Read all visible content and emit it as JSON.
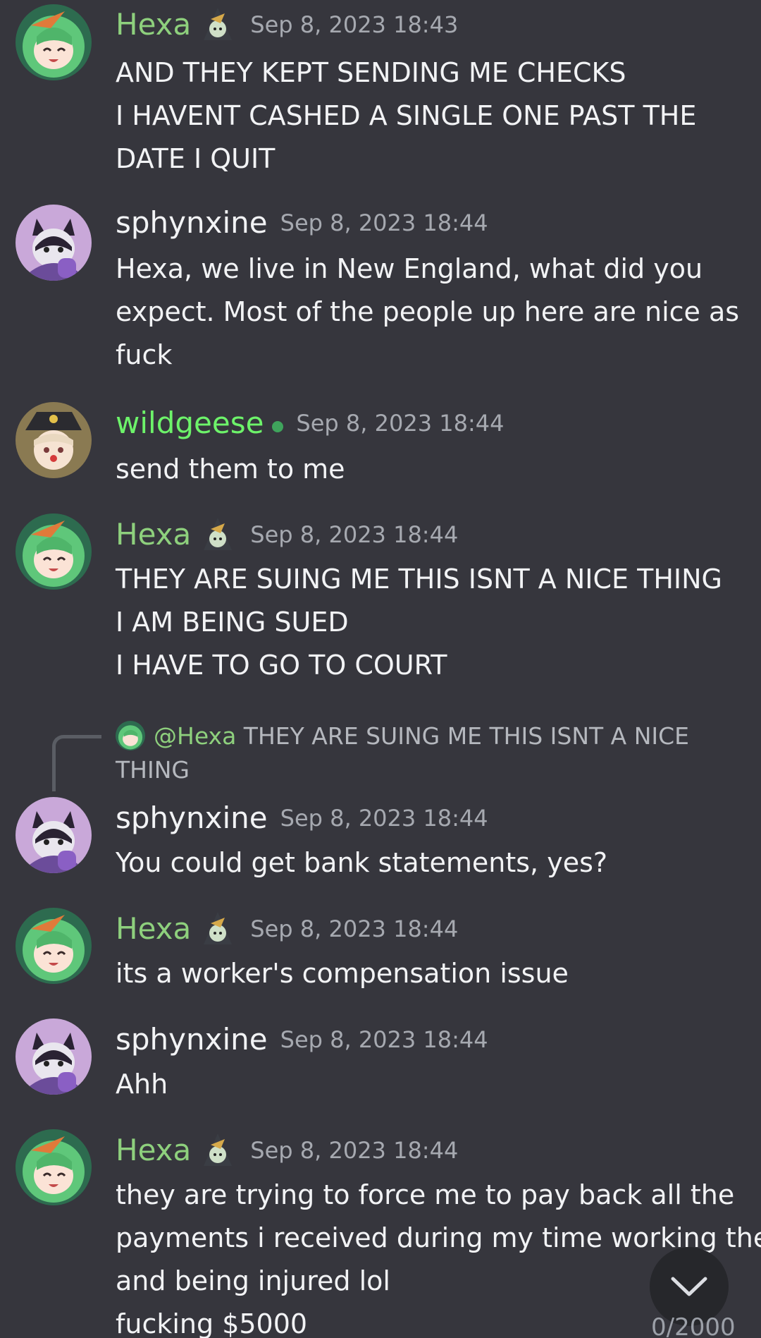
{
  "colors": {
    "background": "#36363d",
    "hexa_name": "#8ed07d",
    "sphynxine_name": "#f2f3f5",
    "wildgeese_name": "#6df36a",
    "online_dot": "#3fa45c",
    "timestamp": "#a6a9b0"
  },
  "messages": [
    {
      "author": "Hexa",
      "timestamp": "Sep 8, 2023 18:43",
      "lines": [
        "AND THEY KEPT SENDING ME CHECKS",
        "I HAVENT CASHED A SINGLE ONE PAST THE",
        "DATE I QUIT"
      ]
    },
    {
      "author": "sphynxine",
      "timestamp": "Sep 8, 2023 18:44",
      "lines": [
        "Hexa, we live in New England, what did you",
        "expect. Most of the people up here are nice as",
        "fuck"
      ]
    },
    {
      "author": "wildgeese",
      "timestamp": "Sep 8, 2023 18:44",
      "lines": [
        "send them to me"
      ]
    },
    {
      "author": "Hexa",
      "timestamp": "Sep 8, 2023 18:44",
      "lines": [
        "THEY ARE SUING ME THIS ISNT A NICE THING",
        "I AM BEING SUED",
        "I HAVE TO GO TO COURT"
      ]
    },
    {
      "author": "sphynxine",
      "timestamp": "Sep 8, 2023 18:44",
      "lines": [
        "You could get bank statements, yes?"
      ]
    },
    {
      "author": "Hexa",
      "timestamp": "Sep 8, 2023 18:44",
      "lines": [
        "its a worker's compensation issue"
      ]
    },
    {
      "author": "sphynxine",
      "timestamp": "Sep 8, 2023 18:44",
      "lines": [
        "Ahh"
      ]
    },
    {
      "author": "Hexa",
      "timestamp": "Sep 8, 2023 18:44",
      "lines": [
        "they are trying to force me to pay back all the",
        "payments i received during my time working there",
        "and being injured lol",
        "fucking $5000"
      ]
    }
  ],
  "reply": {
    "mention": "@Hexa",
    "text": "THEY ARE SUING ME THIS ISNT A NICE THING"
  },
  "composer": {
    "char_counter": "0/2000"
  },
  "icons": {
    "scroll_button": "chevron-down-icon"
  }
}
